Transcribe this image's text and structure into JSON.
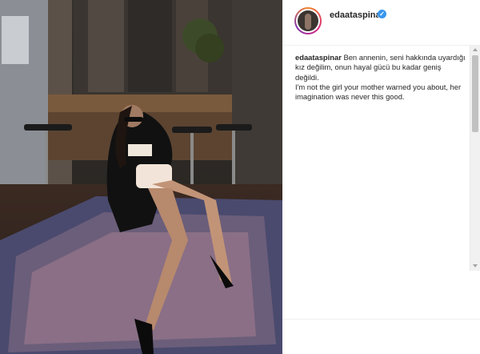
{
  "post": {
    "username": "edaataspinar",
    "more": "•••",
    "caption_turkish": "Ben annenin, seni hakkında uyardığı kız değilim, onun hayal gücü bu kadar geniş değildi.",
    "caption_english": "I'm not the girl your mother warned you about, her imagination was never this good.",
    "emoji_tail": "☁"
  },
  "icons": {
    "verified": "verified-badge-icon",
    "avatar": "profile-avatar"
  },
  "colors": {
    "verified_blue": "#3897f0",
    "text": "#262626"
  }
}
